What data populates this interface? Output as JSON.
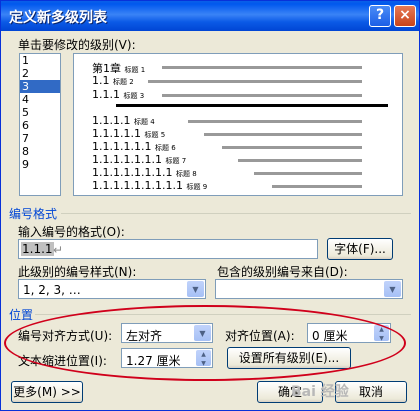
{
  "window": {
    "title": "定义新多级列表",
    "help_label": "?",
    "close_label": "×"
  },
  "level_select": {
    "label": "单击要修改的级别(V):",
    "levels": [
      "1",
      "2",
      "3",
      "4",
      "5",
      "6",
      "7",
      "8",
      "9"
    ],
    "selected": "3"
  },
  "preview": {
    "rows": [
      {
        "num": "第1章",
        "tag": "标题 1"
      },
      {
        "num": "1.1",
        "tag": "标题 2"
      },
      {
        "num": "1.1.1",
        "tag": "标题 3"
      },
      {
        "num": "1.1.1.1",
        "tag": "标题 4"
      },
      {
        "num": "1.1.1.1.1",
        "tag": "标题 5"
      },
      {
        "num": "1.1.1.1.1.1",
        "tag": "标题 6"
      },
      {
        "num": "1.1.1.1.1.1.1",
        "tag": "标题 7"
      },
      {
        "num": "1.1.1.1.1.1.1.1",
        "tag": "标题 8"
      },
      {
        "num": "1.1.1.1.1.1.1.1.1",
        "tag": "标题 9"
      }
    ]
  },
  "number_format": {
    "section_label": "编号格式",
    "format_label": "输入编号的格式(O):",
    "format_value": "1.1.1",
    "format_mark": "↵",
    "font_button": "字体(F)...",
    "style_label": "此级别的编号样式(N):",
    "style_value": "1, 2, 3, …",
    "include_label": "包含的级别编号来自(D):",
    "include_value": ""
  },
  "position": {
    "section_label": "位置",
    "align_label": "编号对齐方式(U):",
    "align_value": "左对齐",
    "align_at_label": "对齐位置(A):",
    "align_at_value": "0 厘米",
    "indent_label": "文本缩进位置(I):",
    "indent_value": "1.27 厘米",
    "set_all_button": "设置所有级别(E)..."
  },
  "footer": {
    "more_button": "更多(M) >>",
    "ok_button": "确定",
    "cancel_button": "取消"
  },
  "watermark": "Bai 经验",
  "colors": {
    "title_bar": "#0058ee",
    "section_label": "#0046d5",
    "annotation": "#d0001b",
    "selection": "#316ac5"
  }
}
